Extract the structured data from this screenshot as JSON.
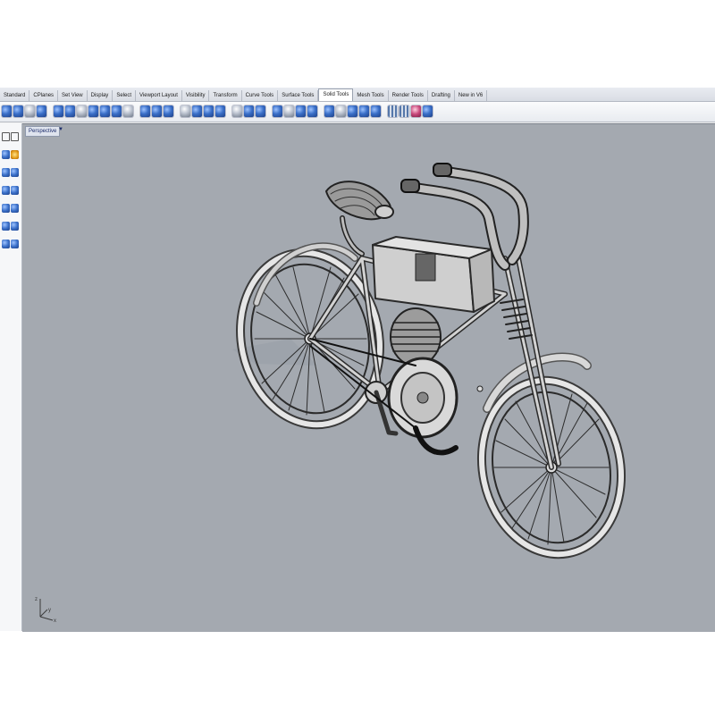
{
  "tabs": [
    "Standard",
    "CPlanes",
    "Set View",
    "Display",
    "Select",
    "Viewport Layout",
    "Visibility",
    "Transform",
    "Curve Tools",
    "Surface Tools",
    "Solid Tools",
    "Mesh Tools",
    "Render Tools",
    "Drafting",
    "New in V6"
  ],
  "active_tab": "Solid Tools",
  "viewport": {
    "title": "Perspective"
  },
  "toolbar_icons": [
    "solid-tool-icon",
    "solid-tool-icon",
    "solid-tool-icon",
    "solid-tool-icon",
    "boolean-icon",
    "boolean-icon",
    "boolean-icon",
    "boolean-icon",
    "boolean-icon",
    "boolean-icon",
    "boolean-icon",
    "cap-icon",
    "cap-icon",
    "cap-icon",
    "fillet-icon",
    "fillet-icon",
    "fillet-icon",
    "fillet-icon",
    "shell-icon",
    "shell-icon",
    "shell-icon",
    "extrude-icon",
    "extrude-icon",
    "extrude-icon",
    "extrude-icon",
    "solid-edit-icon",
    "solid-edit-icon",
    "solid-edit-icon",
    "solid-edit-icon",
    "solid-edit-icon",
    "grid-icon",
    "grid-icon",
    "pink-icon",
    "solid-tool-icon"
  ],
  "colors": {
    "viewport_bg": "#a4a9b0",
    "accent": "#3a6fc8",
    "model_wire": "#2a2a2a",
    "model_surface": "#d9d9d9"
  }
}
